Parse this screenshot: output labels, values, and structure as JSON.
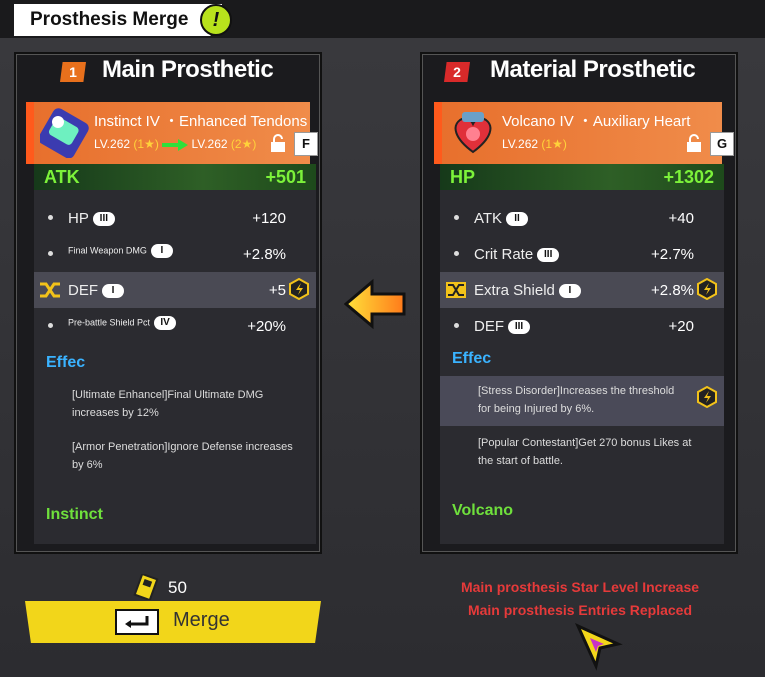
{
  "window": {
    "title": "Prosthesis Merge",
    "alert_glyph": "!"
  },
  "main_panel": {
    "number": "1",
    "title": "Main Prosthetic",
    "item": {
      "name": "Instinct IV ・Enhanced Tendons",
      "level_from": "LV.262",
      "star_from": "(1",
      "level_to": "LV.262",
      "star_to": "(2",
      "key_hint": "F"
    },
    "main_stat": {
      "label": "ATK",
      "value": "+501"
    },
    "rows": [
      {
        "label": "HP",
        "tier": "III",
        "value": "+120"
      },
      {
        "label": "Final Weapon DMG",
        "tier": "I",
        "value": "+2.8%"
      },
      {
        "label": "DEF",
        "tier": "I",
        "value": "+5"
      },
      {
        "label": "Pre-battle Shield Pct",
        "tier": "IV",
        "value": "+20%"
      }
    ],
    "effect_title": "Effec",
    "effects": [
      "[Ultimate Enhancel]Final Ultimate DMG increases by 12%",
      "[Armor Penetration]Ignore Defense increases by 6%"
    ],
    "set_title": "Instinct"
  },
  "material_panel": {
    "number": "2",
    "title": "Material Prosthetic",
    "item": {
      "name": "Volcano IV ・Auxiliary Heart",
      "level": "LV.262",
      "star": "(1",
      "key_hint": "G"
    },
    "main_stat": {
      "label": "HP",
      "value": "+1302"
    },
    "rows": [
      {
        "label": "ATK",
        "tier": "II",
        "value": "+40"
      },
      {
        "label": "Crit Rate",
        "tier": "III",
        "value": "+2.7%"
      },
      {
        "label": "Extra Shield",
        "tier": "I",
        "value": "+2.8%"
      },
      {
        "label": "DEF",
        "tier": "III",
        "value": "+20"
      }
    ],
    "effect_title": "Effec",
    "effects": [
      "[Stress Disorder]Increases the threshold for being Injured by 6%.",
      "[Popular Contestant]Get 270 bonus Likes at the start of battle."
    ],
    "set_title": "Volcano"
  },
  "cost": {
    "value": "50"
  },
  "merge_button": {
    "label": "Merge"
  },
  "notes": [
    "Main prosthesis Star Level Increase",
    "Main prosthesis Entries Replaced"
  ],
  "colors": {
    "accent_green": "#7cf23a",
    "effect_blue": "#3ab3ff",
    "warning_red": "#e63a3a",
    "button_yellow": "#f2d61a",
    "card_orange": "#e76f2c"
  }
}
